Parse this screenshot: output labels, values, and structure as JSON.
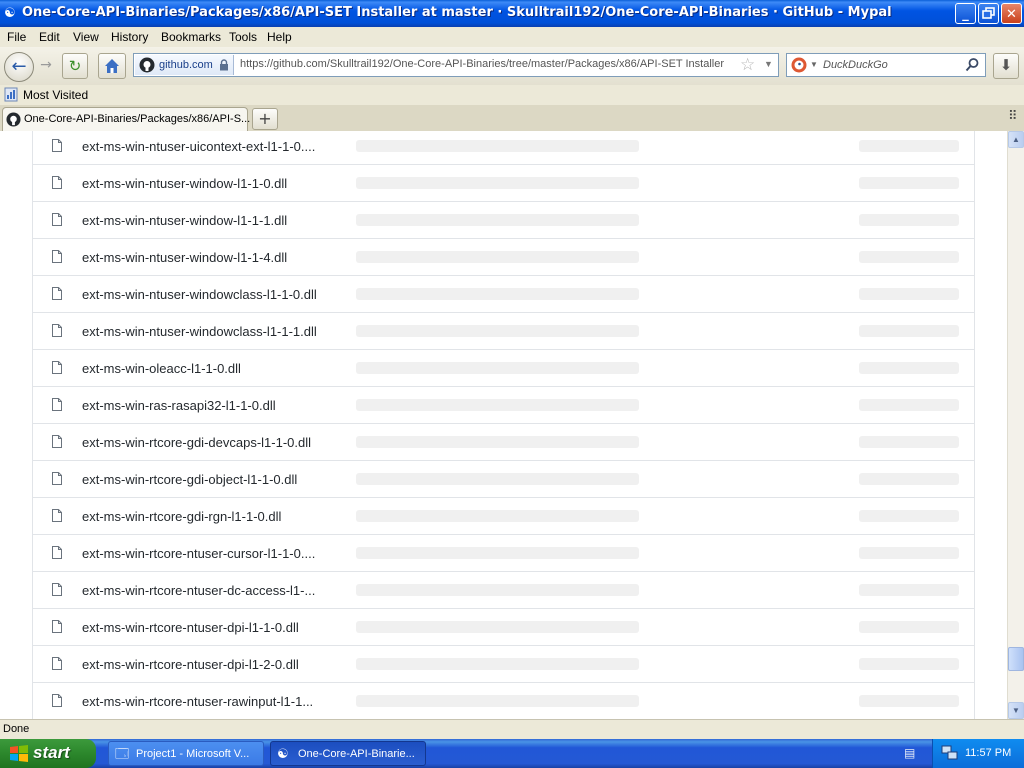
{
  "window": {
    "title": "One-Core-API-Binaries/Packages/x86/API-SET Installer at master · Skulltrail192/One-Core-API-Binaries · GitHub - Mypal",
    "min_label": "_",
    "max_label": "▢",
    "close_label": "✕"
  },
  "menu": [
    "File",
    "Edit",
    "View",
    "History",
    "Bookmarks",
    "Tools",
    "Help"
  ],
  "nav": {
    "site_identity": "github.com",
    "url": "https://github.com/Skulltrail192/One-Core-API-Binaries/tree/master/Packages/x86/API-SET Installer",
    "search_placeholder": "DuckDuckGo"
  },
  "bookmarks": {
    "most_visited": "Most Visited"
  },
  "tab": {
    "title": "One-Core-API-Binaries/Packages/x86/API-S...",
    "new_tab": "+"
  },
  "files": [
    "ext-ms-win-ntuser-uicontext-ext-l1-1-0....",
    "ext-ms-win-ntuser-window-l1-1-0.dll",
    "ext-ms-win-ntuser-window-l1-1-1.dll",
    "ext-ms-win-ntuser-window-l1-1-4.dll",
    "ext-ms-win-ntuser-windowclass-l1-1-0.dll",
    "ext-ms-win-ntuser-windowclass-l1-1-1.dll",
    "ext-ms-win-oleacc-l1-1-0.dll",
    "ext-ms-win-ras-rasapi32-l1-1-0.dll",
    "ext-ms-win-rtcore-gdi-devcaps-l1-1-0.dll",
    "ext-ms-win-rtcore-gdi-object-l1-1-0.dll",
    "ext-ms-win-rtcore-gdi-rgn-l1-1-0.dll",
    "ext-ms-win-rtcore-ntuser-cursor-l1-1-0....",
    "ext-ms-win-rtcore-ntuser-dc-access-l1-...",
    "ext-ms-win-rtcore-ntuser-dpi-l1-1-0.dll",
    "ext-ms-win-rtcore-ntuser-dpi-l1-2-0.dll",
    "ext-ms-win-rtcore-ntuser-rawinput-l1-1..."
  ],
  "status": {
    "text": "Done"
  },
  "taskbar": {
    "start_label": "start",
    "items": [
      "Project1 - Microsoft V...",
      "One-Core-API-Binarie..."
    ],
    "clock": "11:57 PM"
  }
}
